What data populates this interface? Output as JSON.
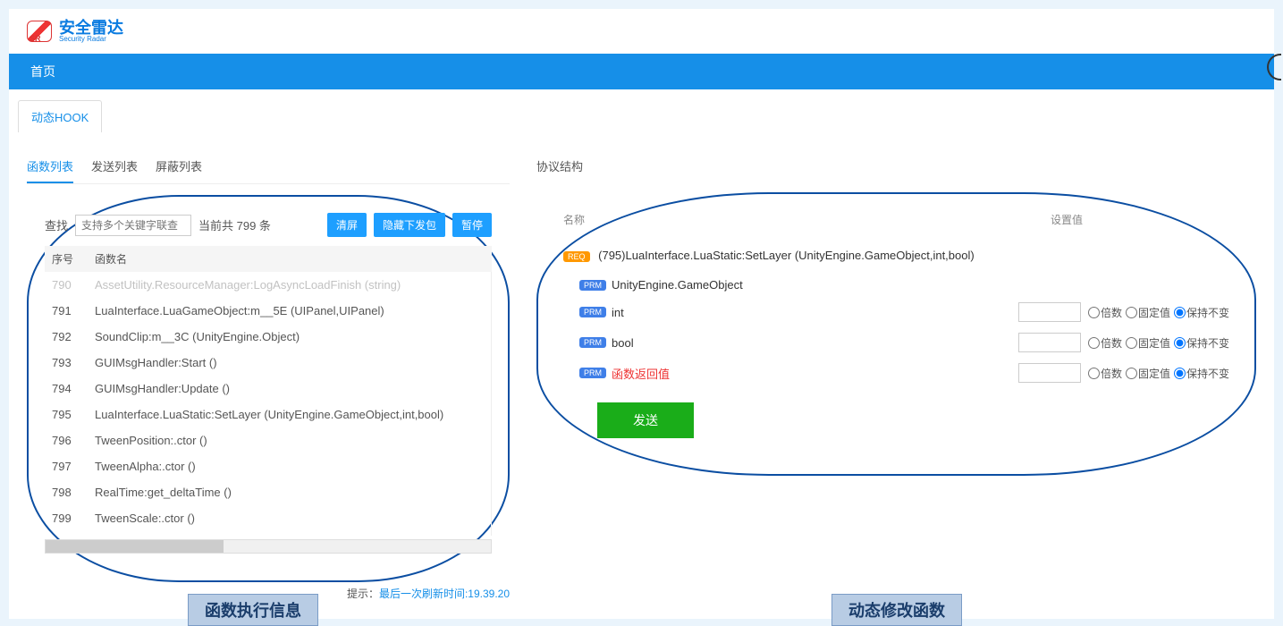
{
  "brand": {
    "title": "安全雷达",
    "subtitle": "Security Radar"
  },
  "nav": {
    "home": "首页"
  },
  "subtab": {
    "hook": "动态HOOK"
  },
  "tabs": {
    "func_list": "函数列表",
    "send_list": "发送列表",
    "block_list": "屏蔽列表"
  },
  "right_title": "协议结构",
  "search": {
    "label": "查找",
    "placeholder": "支持多个关键字联查",
    "count": "当前共 799 条",
    "btn_clear": "清屏",
    "btn_hide": "隐藏下发包",
    "btn_pause": "暂停"
  },
  "table_head": {
    "seq": "序号",
    "name": "函数名"
  },
  "rows": [
    {
      "seq": "790",
      "name": "AssetUtility.ResourceManager:LogAsyncLoadFinish (string)"
    },
    {
      "seq": "791",
      "name": "LuaInterface.LuaGameObject:m__5E (UIPanel,UIPanel)"
    },
    {
      "seq": "792",
      "name": "SoundClip:m__3C (UnityEngine.Object)"
    },
    {
      "seq": "793",
      "name": "GUIMsgHandler:Start ()"
    },
    {
      "seq": "794",
      "name": "GUIMsgHandler:Update ()"
    },
    {
      "seq": "795",
      "name": "LuaInterface.LuaStatic:SetLayer (UnityEngine.GameObject,int,bool)"
    },
    {
      "seq": "796",
      "name": "TweenPosition:.ctor ()"
    },
    {
      "seq": "797",
      "name": "TweenAlpha:.ctor ()"
    },
    {
      "seq": "798",
      "name": "RealTime:get_deltaTime ()"
    },
    {
      "seq": "799",
      "name": "TweenScale:.ctor ()"
    }
  ],
  "hint": {
    "prefix": "提示：",
    "link": "最后一次刷新时间:19.39.20"
  },
  "right_head": {
    "name": "名称",
    "val": "设置值"
  },
  "badges": {
    "req": "REQ",
    "prm": "PRM"
  },
  "detail": {
    "title": "(795)LuaInterface.LuaStatic:SetLayer (UnityEngine.GameObject,int,bool)",
    "p1": "UnityEngine.GameObject",
    "p2": "int",
    "p3": "bool",
    "p4": "函数返回值",
    "r1": "倍数",
    "r2": "固定值",
    "r3": "保持不变",
    "send": "发送"
  },
  "captions": {
    "left": "函数执行信息",
    "right": "动态修改函数"
  }
}
